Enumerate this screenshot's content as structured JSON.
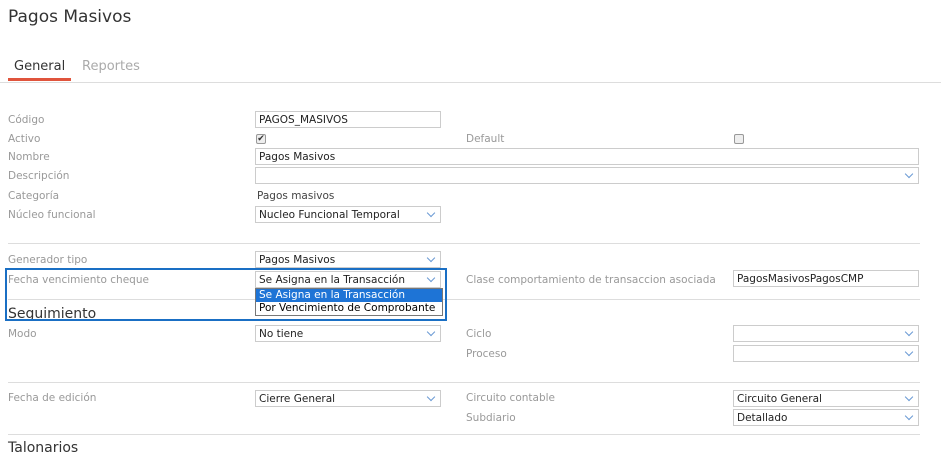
{
  "page": {
    "title": "Pagos Masivos"
  },
  "tabs": [
    {
      "label": "General",
      "active": true
    },
    {
      "label": "Reportes",
      "active": false
    }
  ],
  "fields": {
    "codigo": {
      "label": "Código",
      "value": "PAGOS_MASIVOS"
    },
    "activo": {
      "label": "Activo",
      "checked": true
    },
    "default": {
      "label": "Default",
      "checked": false
    },
    "nombre": {
      "label": "Nombre",
      "value": "Pagos Masivos"
    },
    "descripcion": {
      "label": "Descripción",
      "value": ""
    },
    "categoria": {
      "label": "Categoría",
      "value": "Pagos masivos"
    },
    "nucleo": {
      "label": "Núcleo funcional",
      "value": "Nucleo Funcional Temporal"
    },
    "generador": {
      "label": "Generador tipo",
      "value": "Pagos Masivos"
    },
    "fecha_venc": {
      "label": "Fecha vencimiento cheque",
      "value": "Se Asigna en la Transacción",
      "options": [
        "Se Asigna en la Transacción",
        "Por Vencimiento de Comprobante"
      ]
    },
    "clase": {
      "label": "Clase comportamiento de transaccion asociada",
      "value": "PagosMasivosPagosCMP"
    },
    "modo": {
      "label": "Modo",
      "value": "No tiene"
    },
    "ciclo": {
      "label": "Ciclo",
      "value": ""
    },
    "proceso": {
      "label": "Proceso",
      "value": ""
    },
    "fecha_edicion": {
      "label": "Fecha de edición",
      "value": "Cierre General"
    },
    "circuito": {
      "label": "Circuito contable",
      "value": "Circuito General"
    },
    "subdiario": {
      "label": "Subdiario",
      "value": "Detallado"
    }
  },
  "sections": {
    "seguimiento": "Seguimiento",
    "talonarios": "Talonarios"
  },
  "colors": {
    "accent": "#e0543c",
    "highlight": "#1a6fc4"
  }
}
